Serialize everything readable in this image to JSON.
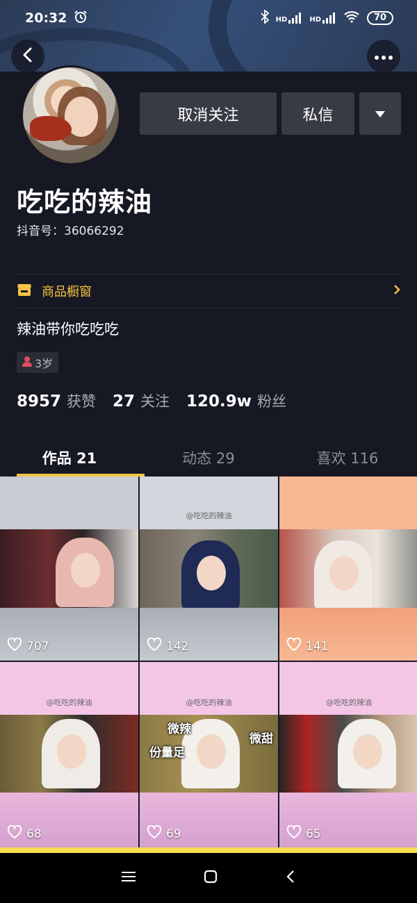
{
  "status_bar": {
    "time": "20:32",
    "battery": "70",
    "hd1": "HD",
    "hd2": "HD"
  },
  "header": {
    "back_icon": "back-arrow-icon",
    "more_icon": "more-dots-icon"
  },
  "profile": {
    "unfollow_label": "取消关注",
    "message_label": "私信",
    "name": "吃吃的辣油",
    "douyin_id": "抖音号：36066292",
    "shop_label": "商品橱窗",
    "bio": "辣油带你吃吃吃",
    "age_tag": "3岁"
  },
  "stats": {
    "likes_num": "8957",
    "likes_label": "获赞",
    "following_num": "27",
    "following_label": "关注",
    "followers_num": "120.9w",
    "followers_label": "粉丝"
  },
  "tabs": [
    {
      "label": "作品 21"
    },
    {
      "label": "动态 29"
    },
    {
      "label": "喜欢 116"
    }
  ],
  "videos": [
    {
      "likes": "707",
      "watermark": ""
    },
    {
      "likes": "142",
      "watermark": "@吃吃的辣油"
    },
    {
      "likes": "141",
      "watermark": ""
    },
    {
      "likes": "68",
      "watermark": "@吃吃的辣油"
    },
    {
      "likes": "69",
      "watermark": "@吃吃的辣油",
      "text1": "微辣",
      "text2": "份量足",
      "text3": "微甜"
    },
    {
      "likes": "65",
      "watermark": "@吃吃的辣油"
    }
  ],
  "colors": {
    "accent": "#f6c343",
    "background": "#161823",
    "button": "#393b44"
  }
}
